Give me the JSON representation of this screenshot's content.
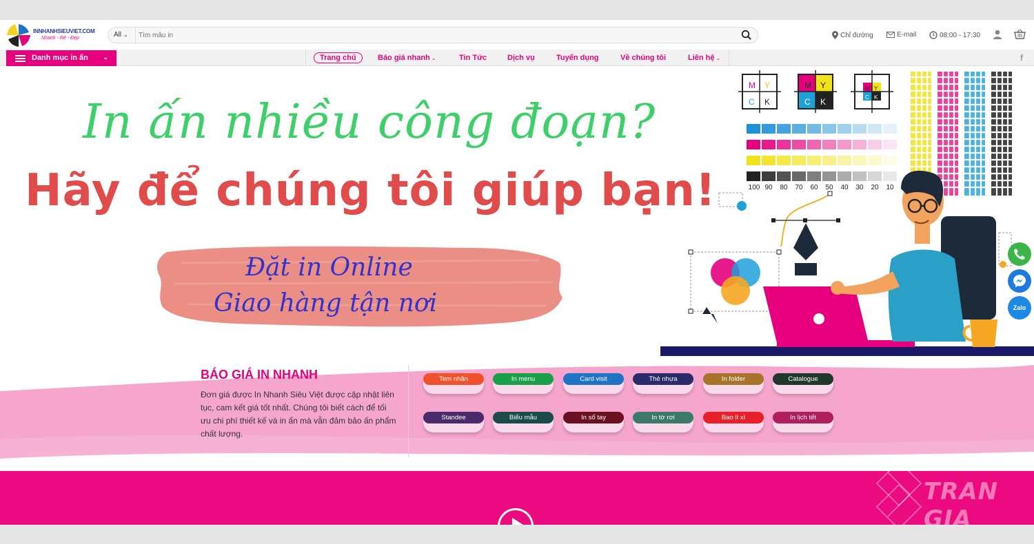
{
  "header": {
    "logo_text": "INNHANHSIEUVIET.COM",
    "logo_slogan": "Nhanh - Rẻ - Đẹp",
    "search": {
      "category": "All",
      "placeholder": "Tìm mẫu in"
    },
    "info": {
      "directions": "Chỉ đường",
      "email": "E-mail",
      "hours": "08:00 - 17:30"
    }
  },
  "nav": {
    "category_button": "Danh mục in ấn",
    "items": [
      "Trang chủ",
      "Báo giá nhanh",
      "Tin Tức",
      "Dịch vụ",
      "Tuyển dụng",
      "Về chúng tôi",
      "Liên hệ"
    ],
    "facebook": "f"
  },
  "hero": {
    "line1": "In ấn nhiều công đoạn?",
    "line2": "Hãy để chúng tôi giúp bạn!",
    "brush_line1": "Đặt in Online",
    "brush_line2": "Giao hàng tận nơi",
    "color_squares": [
      {
        "m": "M",
        "y": "Y",
        "c": "C",
        "k": "K"
      },
      {
        "m": "M",
        "y": "Y",
        "c": "C",
        "k": "K"
      },
      {
        "m": "M",
        "y": "Y",
        "c": "C",
        "k": "K"
      }
    ],
    "scale_labels": [
      "100",
      "90",
      "80",
      "70",
      "60",
      "50",
      "40",
      "30",
      "20",
      "10"
    ],
    "zalo_label": "Zalo"
  },
  "pricing": {
    "title": "BÁO GIÁ IN NHANH",
    "description": "Đơn giá được In Nhanh Siêu Việt được cập nhật liên tục, cam kết giá tốt nhất. Chúng tôi biết cách để tối ưu chi phí thiết kế và in ấn mà vẫn đảm bảo ấn phẩm chất lượng.",
    "buttons": [
      {
        "label": "Tem nhãn",
        "color": "#f0532b"
      },
      {
        "label": "In menu",
        "color": "#1aa04b"
      },
      {
        "label": "Card visit",
        "color": "#1f73c7"
      },
      {
        "label": "Thẻ nhựa",
        "color": "#2b2a6b"
      },
      {
        "label": "In folder",
        "color": "#a8742a"
      },
      {
        "label": "Catalogue",
        "color": "#1f3a2c"
      },
      {
        "label": "Standee",
        "color": "#4b2a6b"
      },
      {
        "label": "Biểu mẫu",
        "color": "#1b4a4a"
      },
      {
        "label": "In sổ tay",
        "color": "#6b1020"
      },
      {
        "label": "In tờ rơi",
        "color": "#3b7a6b"
      },
      {
        "label": "Bao lì xì",
        "color": "#e8202a"
      },
      {
        "label": "In lịch tết",
        "color": "#b01e5e"
      }
    ]
  },
  "watermark": "TRAN GIA",
  "colors": {
    "brand_pink": "#e6007e",
    "hero_green": "#3ecf6a",
    "hero_red": "#e04b4b",
    "brush_blue": "#3433c9"
  }
}
